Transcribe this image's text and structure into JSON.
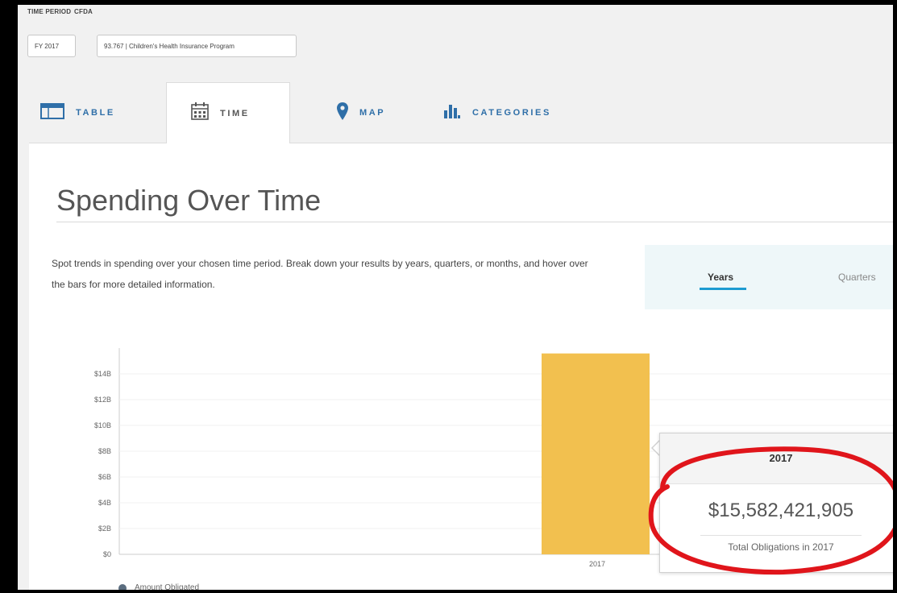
{
  "filters": {
    "time_period_label": "TIME PERIOD",
    "time_period_value": "FY 2017",
    "cfda_label": "CFDA",
    "cfda_value": "93.767 | Children's Health Insurance Program"
  },
  "tabs": [
    {
      "label": "TABLE",
      "icon": "table-icon",
      "active": false
    },
    {
      "label": "TIME",
      "icon": "calendar-icon",
      "active": true
    },
    {
      "label": "MAP",
      "icon": "map-pin-icon",
      "active": false
    },
    {
      "label": "CATEGORIES",
      "icon": "bar-chart-icon",
      "active": false
    }
  ],
  "section": {
    "title": "Spending Over Time",
    "description": "Spot trends in spending over your chosen time period. Break down your results by years, quarters, or months, and hover over the bars for more detailed information."
  },
  "period_toggle": {
    "options": [
      "Years",
      "Quarters"
    ],
    "selected": "Years"
  },
  "chart_data": {
    "type": "bar",
    "categories": [
      "2017"
    ],
    "values": [
      15582421905
    ],
    "y_ticks": [
      "$0",
      "$2B",
      "$4B",
      "$6B",
      "$8B",
      "$10B",
      "$12B",
      "$14B"
    ],
    "ylim": [
      0,
      16000000000
    ],
    "bar_color": "#f2c04f",
    "grid": true,
    "legend": [
      {
        "name": "Amount Obligated",
        "color": "#5b6d7f"
      }
    ]
  },
  "tooltip": {
    "title": "2017",
    "amount": "$15,582,421,905",
    "subtitle": "Total Obligations in 2017"
  },
  "colors": {
    "accent": "#2f6fa8",
    "bar": "#f2c04f",
    "annotation": "#e0151b",
    "toggle_underline": "#1d9bd1"
  }
}
